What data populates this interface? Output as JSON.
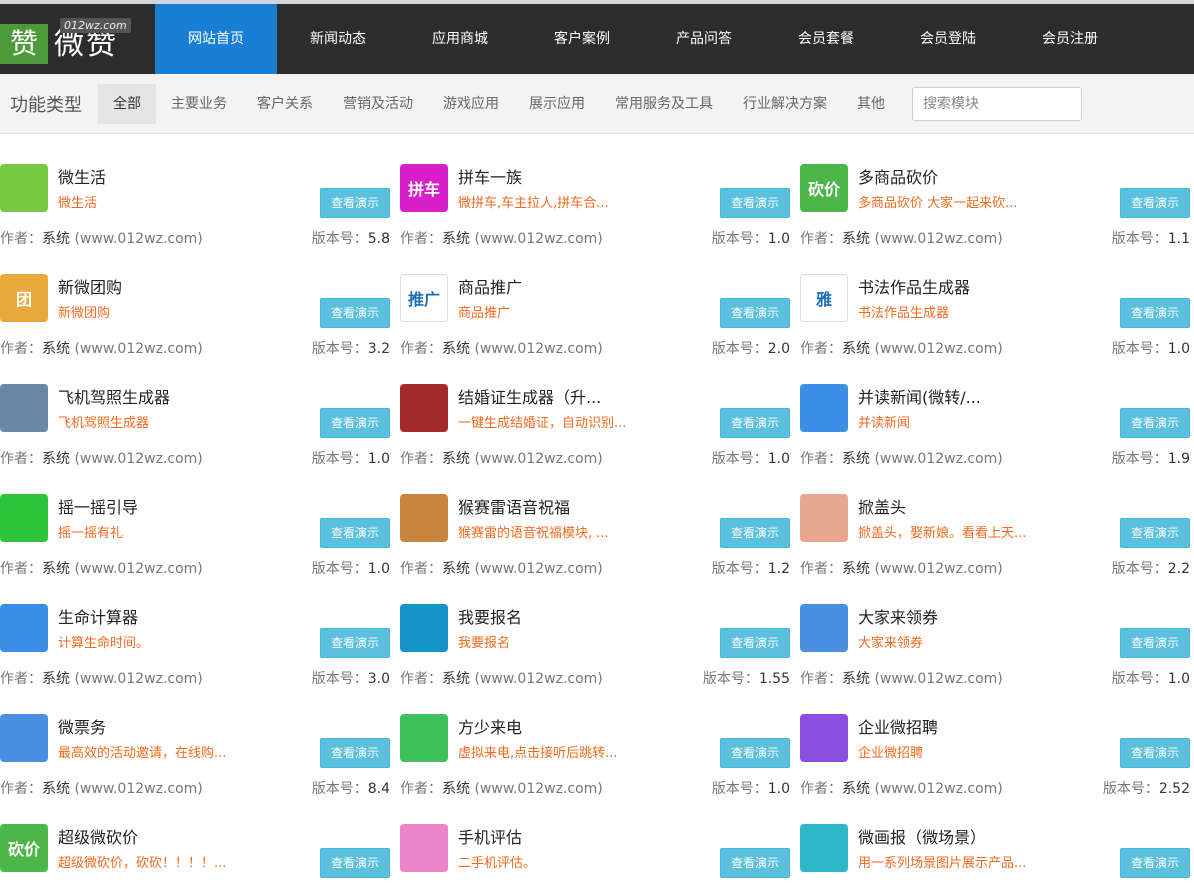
{
  "logo": {
    "mark": "赞",
    "word": "微赞",
    "domain": "012wz.com"
  },
  "nav": [
    {
      "label": "网站首页",
      "active": true
    },
    {
      "label": "新闻动态"
    },
    {
      "label": "应用商城"
    },
    {
      "label": "客户案例"
    },
    {
      "label": "产品问答"
    },
    {
      "label": "会员套餐"
    },
    {
      "label": "会员登陆"
    },
    {
      "label": "会员注册"
    }
  ],
  "filter": {
    "title": "功能类型",
    "items": [
      {
        "label": "全部",
        "active": true
      },
      {
        "label": "主要业务"
      },
      {
        "label": "客户关系"
      },
      {
        "label": "营销及活动"
      },
      {
        "label": "游戏应用"
      },
      {
        "label": "展示应用"
      },
      {
        "label": "常用服务及工具"
      },
      {
        "label": "行业解决方案"
      },
      {
        "label": "其他"
      }
    ],
    "search_placeholder": "搜索模块"
  },
  "labels": {
    "demo": "查看演示",
    "author_prefix": "作者：",
    "author_sys": "系统",
    "author_site": " (www.012wz.com)",
    "version_prefix": "版本号："
  },
  "apps": [
    {
      "name": "微生活",
      "desc": "微生活",
      "version": "5.8",
      "icon": "cup-icon",
      "icon_text": "",
      "color": "#7ac943"
    },
    {
      "name": "拼车一族",
      "desc": "微拼车,车主拉人,拼车合...",
      "version": "1.0",
      "icon": "carpool-icon",
      "icon_text": "拼车",
      "color": "#d81ec9"
    },
    {
      "name": "多商品砍价",
      "desc": "多商品砍价 大家一起来砍...",
      "version": "1.1",
      "icon": "bargain-icon",
      "icon_text": "砍价",
      "color": "#4cb748"
    },
    {
      "name": "新微团购",
      "desc": "新微团购",
      "version": "3.2",
      "icon": "group-buy-icon",
      "icon_text": "团",
      "color": "#e8a83a"
    },
    {
      "name": "商品推广",
      "desc": "商品推广",
      "version": "2.0",
      "icon": "promote-icon",
      "icon_text": "推广",
      "color": "#ffffff"
    },
    {
      "name": "书法作品生成器",
      "desc": "书法作品生成器",
      "version": "1.0",
      "icon": "calligraphy-icon",
      "icon_text": "雅",
      "color": "#ffffff"
    },
    {
      "name": "飞机驾照生成器",
      "desc": "飞机驾照生成器",
      "version": "1.0",
      "icon": "pilot-badge-icon",
      "icon_text": "",
      "color": "#6a87a8"
    },
    {
      "name": "结婚证生成器（升...",
      "desc": "一键生成结婚证，自动识别...",
      "version": "1.0",
      "icon": "marriage-cert-icon",
      "icon_text": "",
      "color": "#a52a2a"
    },
    {
      "name": "并读新闻(微转/...",
      "desc": "并读新闻",
      "version": "1.9",
      "icon": "news-search-icon",
      "icon_text": "",
      "color": "#3a8ee6"
    },
    {
      "name": "摇一摇引导",
      "desc": "摇一摇有礼",
      "version": "1.0",
      "icon": "shake-phone-icon",
      "icon_text": "",
      "color": "#2cc53c"
    },
    {
      "name": "猴赛雷语音祝福",
      "desc": "猴赛雷的语音祝福模块, ...",
      "version": "1.2",
      "icon": "monkey-icon",
      "icon_text": "",
      "color": "#c8863c"
    },
    {
      "name": "掀盖头",
      "desc": "掀盖头，娶新娘。看看上天...",
      "version": "2.2",
      "icon": "bride-face-icon",
      "icon_text": "",
      "color": "#e8a890"
    },
    {
      "name": "生命计算器",
      "desc": "计算生命时间。",
      "version": "3.0",
      "icon": "calculator-icon",
      "icon_text": "",
      "color": "#3a8ee6"
    },
    {
      "name": "我要报名",
      "desc": "我要报名",
      "version": "1.55",
      "icon": "pencil-icon",
      "icon_text": "",
      "color": "#1596c8"
    },
    {
      "name": "大家来领券",
      "desc": "大家来领券",
      "version": "1.0",
      "icon": "coupon-icon",
      "icon_text": "",
      "color": "#4a90e2"
    },
    {
      "name": "微票务",
      "desc": "最高效的活动邀请，在线购...",
      "version": "8.4",
      "icon": "ticket-icon",
      "icon_text": "",
      "color": "#4a90e2"
    },
    {
      "name": "方少来电",
      "desc": "虚拟来电,点击接听后跳转...",
      "version": "1.0",
      "icon": "phone-icon",
      "icon_text": "",
      "color": "#3dc15b"
    },
    {
      "name": "企业微招聘",
      "desc": "企业微招聘",
      "version": "2.52",
      "icon": "recruit-icon",
      "icon_text": "",
      "color": "#8a4fe0"
    },
    {
      "name": "超级微砍价",
      "desc": "超级微砍价，砍砍！！！！...",
      "version": "",
      "icon": "bargain-icon",
      "icon_text": "砍价",
      "color": "#4cb748"
    },
    {
      "name": "手机评估",
      "desc": "二手机评估。",
      "version": "",
      "icon": "phone-eval-icon",
      "icon_text": "",
      "color": "#e884c8"
    },
    {
      "name": "微画报（微场景）",
      "desc": "用一系列场景图片展示产品...",
      "version": "",
      "icon": "wallet-icon",
      "icon_text": "",
      "color": "#2eb7c9"
    }
  ]
}
